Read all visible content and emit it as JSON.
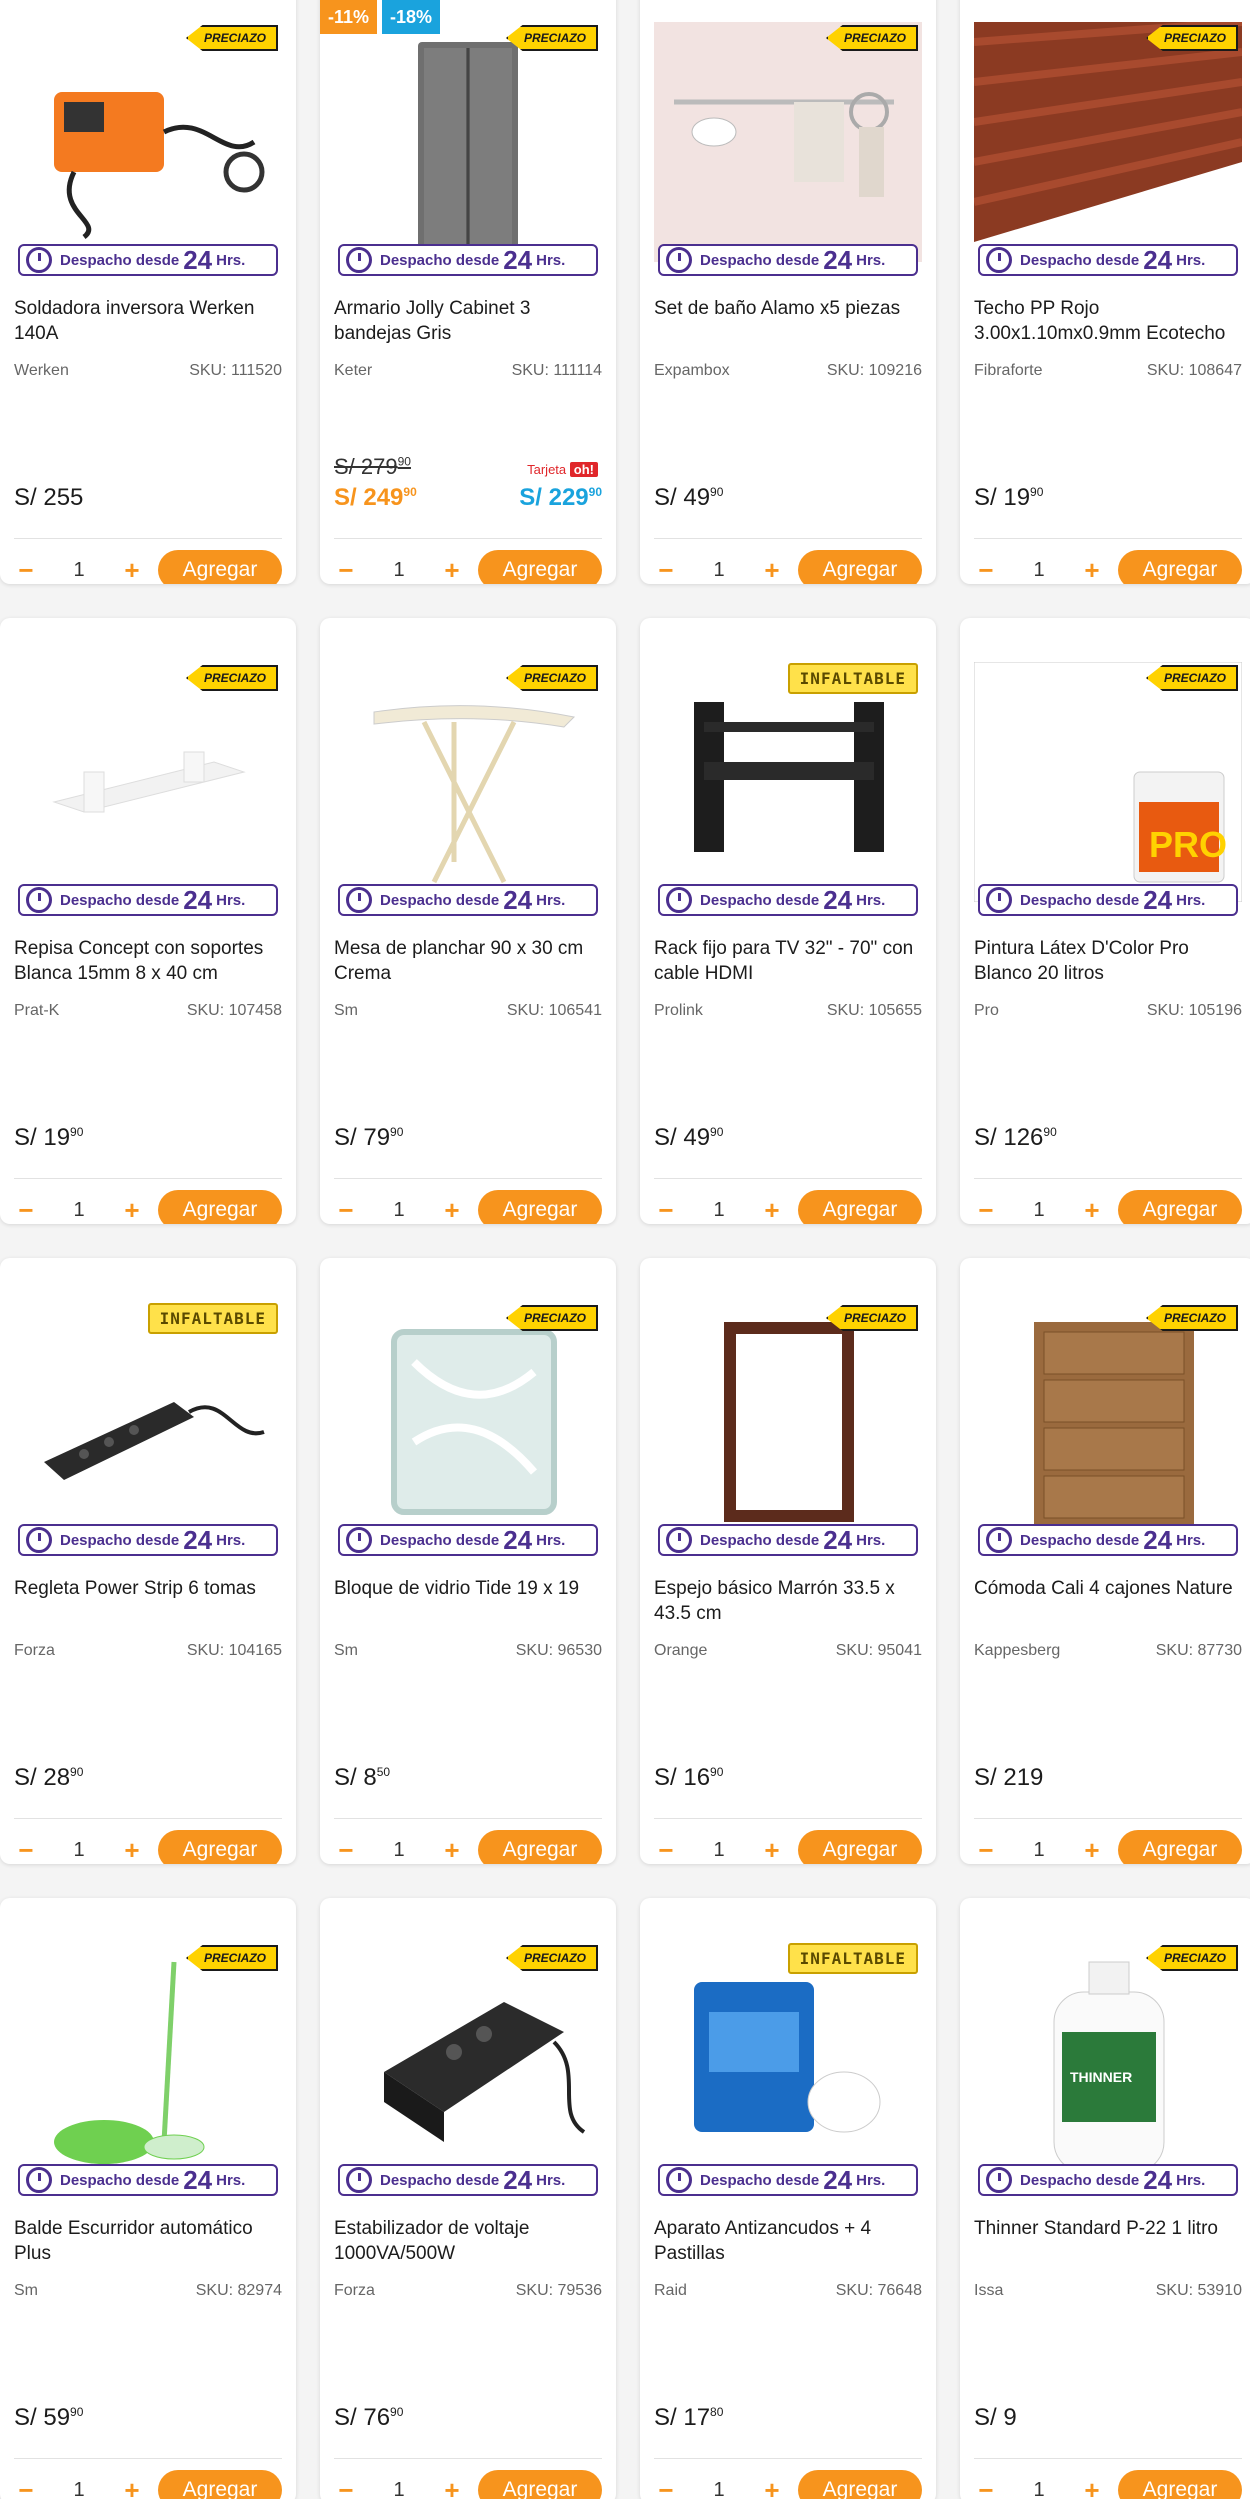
{
  "badges": {
    "precio": "PRECIAZO",
    "infaltable": "INFALTABLE"
  },
  "delivery": {
    "prefix": "Despacho desde",
    "num": "24",
    "suffix": "Hrs."
  },
  "add_label": "Agregar",
  "qty_default": "1",
  "products": [
    {
      "name": "Soldadora inversora Werken 140A",
      "brand": "Werken",
      "sku": "SKU: 111520",
      "price": "S/ 255",
      "cents": "",
      "badge": "precio",
      "icon": "welder-image"
    },
    {
      "name": "Armario Jolly Cabinet 3 bandejas Gris",
      "brand": "Keter",
      "sku": "SKU: 111114",
      "old_price": "S/ 279",
      "old_cents": "90",
      "price": "S/ 249",
      "cents": "90",
      "price_style": "orange",
      "tarjeta_label": "Tarjeta",
      "tarjeta_oh": "oh!",
      "tarjeta_price": "S/ 229",
      "tarjeta_cents": "90",
      "discount1": "-11%",
      "discount2": "-18%",
      "badge": "precio",
      "icon": "cabinet-image"
    },
    {
      "name": "Set de baño Alamo x5 piezas",
      "brand": "Expambox",
      "sku": "SKU: 109216",
      "price": "S/ 49",
      "cents": "90",
      "badge": "precio",
      "icon": "towel-bar-image"
    },
    {
      "name": "Techo PP Rojo 3.00x1.10mx0.9mm Ecotecho",
      "brand": "Fibraforte",
      "sku": "SKU: 108647",
      "price": "S/ 19",
      "cents": "90",
      "badge": "precio",
      "icon": "roof-sheet-image"
    },
    {
      "name": "Repisa Concept con soportes Blanca 15mm 8 x 40 cm",
      "brand": "Prat-K",
      "sku": "SKU: 107458",
      "price": "S/ 19",
      "cents": "90",
      "badge": "precio",
      "icon": "shelf-image"
    },
    {
      "name": "Mesa de planchar 90 x 30 cm Crema",
      "brand": "Sm",
      "sku": "SKU: 106541",
      "price": "S/ 79",
      "cents": "90",
      "badge": "precio",
      "icon": "ironing-board-image"
    },
    {
      "name": "Rack fijo para TV 32\" - 70\" con cable HDMI",
      "brand": "Prolink",
      "sku": "SKU: 105655",
      "price": "S/ 49",
      "cents": "90",
      "badge": "infaltable",
      "icon": "tv-mount-image"
    },
    {
      "name": "Pintura Látex D'Color Pro Blanco 20 litros",
      "brand": "Pro",
      "sku": "SKU: 105196",
      "price": "S/ 126",
      "cents": "90",
      "badge": "precio",
      "icon": "paint-bucket-image"
    },
    {
      "name": "Regleta Power Strip 6 tomas",
      "brand": "Forza",
      "sku": "SKU: 104165",
      "price": "S/ 28",
      "cents": "90",
      "badge": "infaltable",
      "icon": "power-strip-image"
    },
    {
      "name": "Bloque de vidrio Tide 19 x 19",
      "brand": "Sm",
      "sku": "SKU: 96530",
      "price": "S/ 8",
      "cents": "50",
      "badge": "precio",
      "icon": "glass-block-image"
    },
    {
      "name": "Espejo básico Marrón 33.5 x 43.5 cm",
      "brand": "Orange",
      "sku": "SKU: 95041",
      "price": "S/ 16",
      "cents": "90",
      "badge": "precio",
      "icon": "mirror-image"
    },
    {
      "name": "Cómoda Cali 4 cajones Nature",
      "brand": "Kappesberg",
      "sku": "SKU: 87730",
      "price": "S/ 219",
      "cents": "",
      "badge": "precio",
      "icon": "dresser-image"
    },
    {
      "name": "Balde Escurridor automático Plus",
      "brand": "Sm",
      "sku": "SKU: 82974",
      "price": "S/ 59",
      "cents": "90",
      "badge": "precio",
      "icon": "mop-bucket-image"
    },
    {
      "name": "Estabilizador de voltaje 1000VA/500W",
      "brand": "Forza",
      "sku": "SKU: 79536",
      "price": "S/ 76",
      "cents": "90",
      "badge": "precio",
      "icon": "stabilizer-image"
    },
    {
      "name": "Aparato Antizancudos + 4 Pastillas",
      "brand": "Raid",
      "sku": "SKU: 76648",
      "price": "S/ 17",
      "cents": "80",
      "badge": "infaltable",
      "icon": "raid-device-image"
    },
    {
      "name": "Thinner Standard P-22 1 litro",
      "brand": "Issa",
      "sku": "SKU: 53910",
      "price": "S/ 9",
      "cents": "",
      "badge": "precio",
      "icon": "thinner-bottle-image"
    }
  ],
  "colors": {
    "accent": "#f7941d",
    "delivery": "#4b2f8f",
    "tarjeta": "#1aa3dd",
    "discount_blue": "#1aa3dd"
  }
}
